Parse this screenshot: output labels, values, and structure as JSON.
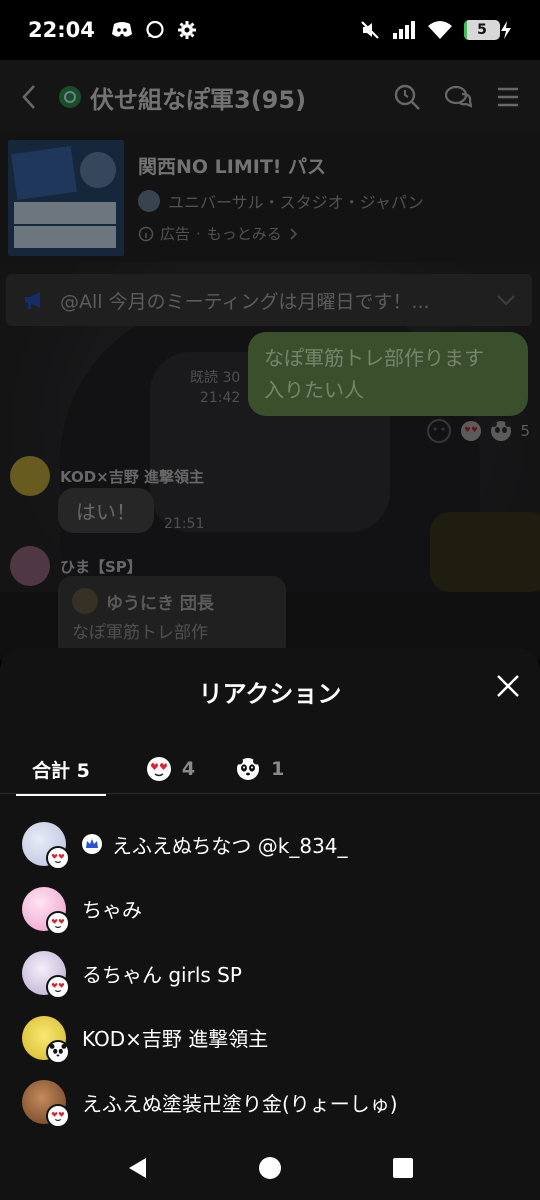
{
  "status_bar": {
    "time": "22:04",
    "battery_level": "5",
    "battery_fraction": 0.05,
    "icons_left": [
      "discord-icon",
      "chat-bubble-icon",
      "settings-gear-icon"
    ],
    "icons_right": [
      "mute-icon",
      "signal-icon",
      "wifi-icon",
      "battery-icon"
    ]
  },
  "chat_header": {
    "title": "伏せ組なぽ軍3(95)",
    "actions": [
      "search-icon",
      "chat-icon",
      "menu-icon"
    ]
  },
  "ad": {
    "title": "関西NO LIMIT! パス",
    "advertiser": "ユニバーサル・スタジオ・ジャパン",
    "label": "広告",
    "more": "もっとみる"
  },
  "announcement": {
    "text": "@All 今月のミーティングは月曜日です！..."
  },
  "messages": {
    "mine": {
      "lines": [
        "なぽ軍筋トレ部作ります",
        "入りたい人"
      ],
      "read": "既読 30",
      "time": "21:42",
      "reaction_count": "5"
    },
    "msg1": {
      "sender": "KOD×吉野 進撃領主",
      "text": "はい！",
      "time": "21:51"
    },
    "msg2": {
      "sender": "ひま【SP】",
      "reply_author": "ゆうにき 団長",
      "reply_text": "なぽ軍筋トレ部作"
    }
  },
  "sheet": {
    "title": "リアクション",
    "tabs": [
      {
        "label": "合計 5"
      },
      {
        "icon": "heart-eyes-icon",
        "count": "4"
      },
      {
        "icon": "panda-icon",
        "count": "1"
      }
    ],
    "users": [
      {
        "name": "えふえぬちなつ @k_834_",
        "reaction": "heart-eyes-icon",
        "avatar_color": "#c7cfe8",
        "crown": true
      },
      {
        "name": "ちゃみ",
        "reaction": "heart-eyes-icon",
        "avatar_color": "#f3b6d9"
      },
      {
        "name": "るちゃん girls SP",
        "reaction": "heart-eyes-icon",
        "avatar_color": "#d8d0e8"
      },
      {
        "name": "KOD×吉野 進撃領主",
        "reaction": "panda-icon",
        "avatar_color": "#e8d24a"
      },
      {
        "name": "えふえぬ塗装卍塗り金(りょーしゅ)",
        "reaction": "heart-eyes-icon",
        "avatar_color": "#8a5a3a"
      }
    ]
  },
  "nav_bar": {
    "buttons": [
      "back-triangle-icon",
      "home-circle-icon",
      "recents-square-icon"
    ]
  }
}
